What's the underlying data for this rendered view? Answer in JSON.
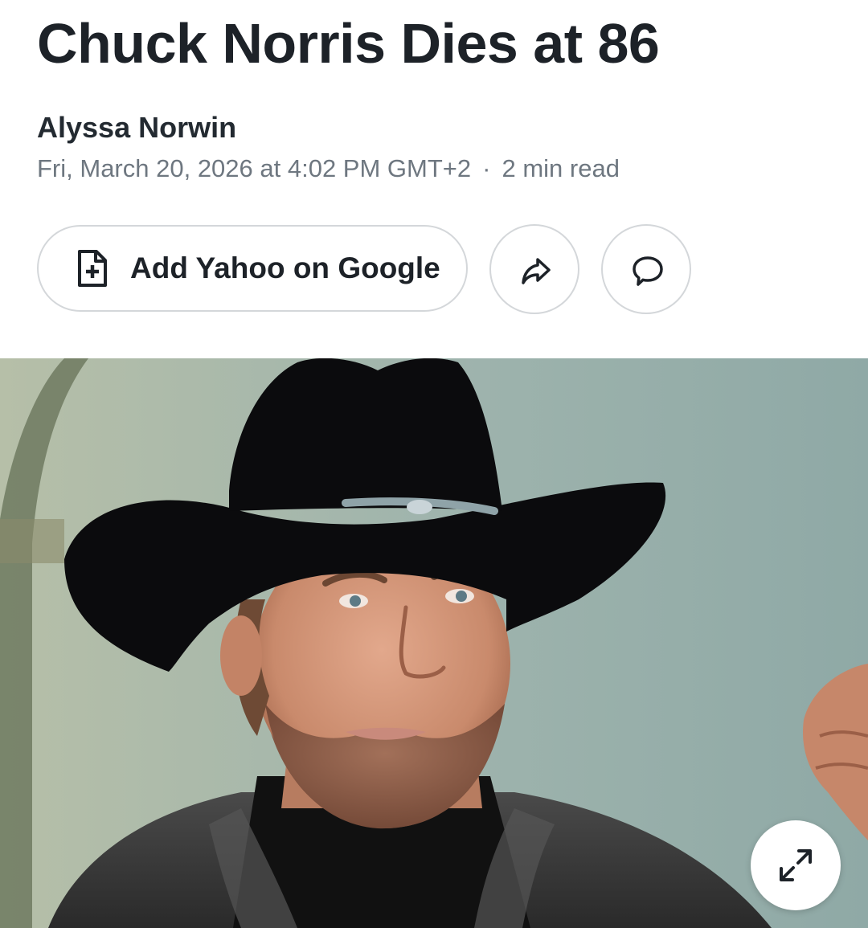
{
  "article": {
    "headline": "Chuck Norris Dies at 86",
    "author": "Alyssa Norwin",
    "timestamp": "Fri, March 20, 2026 at 4:02 PM GMT+2",
    "separator": "·",
    "read_time": "2 min read"
  },
  "actions": {
    "add_source_label": "Add Yahoo on Google",
    "add_source_icon": "document-plus-icon",
    "share_icon": "share-arrow-icon",
    "comment_icon": "speech-bubble-icon"
  },
  "hero_image": {
    "expand_icon": "expand-arrows-icon"
  },
  "colors": {
    "text_primary": "#1d2228",
    "text_meta": "#6e7780",
    "button_border": "#d4d7da"
  }
}
